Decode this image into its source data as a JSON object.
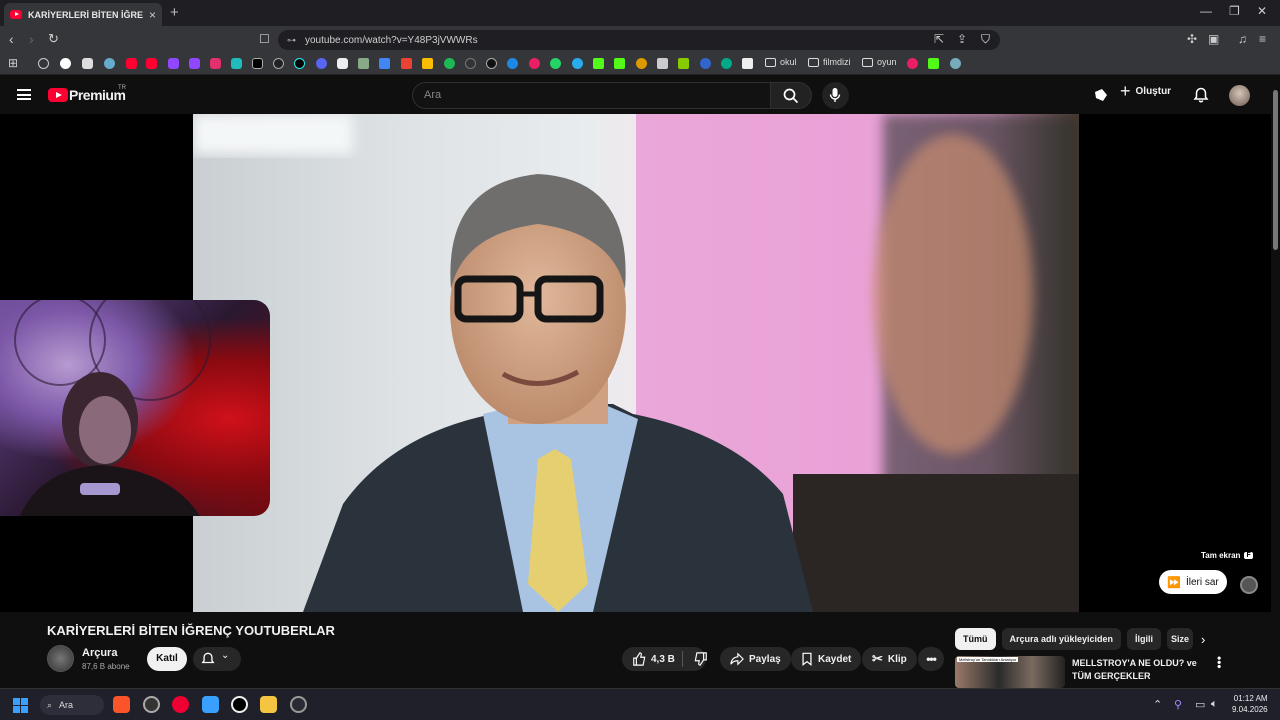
{
  "browser": {
    "tab_title": "KARİYERLERİ BİTEN İĞRENÇ YOUTUBERLAR",
    "tab_close": "×",
    "new_tab": "+",
    "url": "youtube.com/watch?v=Y48P3jVWWRs",
    "bookmark_folders": [
      "okul",
      "filmdizi",
      "oyun"
    ]
  },
  "youtube": {
    "brand": "Premium",
    "region": "TR",
    "search_placeholder": "Ara",
    "create_label": "Oluştur"
  },
  "player": {
    "fullscreen_label": "Tam ekran",
    "fullscreen_key": "F",
    "skip_label": "İleri sar"
  },
  "video": {
    "title": "KARİYERLERİ BİTEN İĞRENÇ YOUTUBERLAR",
    "channel_name": "Arçura",
    "subscribers": "87,6 B abone",
    "join_label": "Katıl",
    "likes": "4,3 B",
    "share_label": "Paylaş",
    "save_label": "Kaydet",
    "clip_label": "Klip"
  },
  "sidebar": {
    "chips": [
      "Tümü",
      "Arçura adlı yükleyiciden",
      "İlgili",
      "Size"
    ],
    "recommendation_title": "MELLSTROY'A NE OLDU? ve TÜM GERÇEKLER",
    "recommendation_thumb_text": "Mellstroy'un Tanıdıkları Anlatıyor"
  },
  "taskbar": {
    "search_label": "Ara",
    "time": "01:12 AM",
    "date": "9.04.2026"
  },
  "colors": {
    "accent_red": "#ff0033",
    "background": "#0f0f0f",
    "chrome_dark": "#35363a"
  }
}
